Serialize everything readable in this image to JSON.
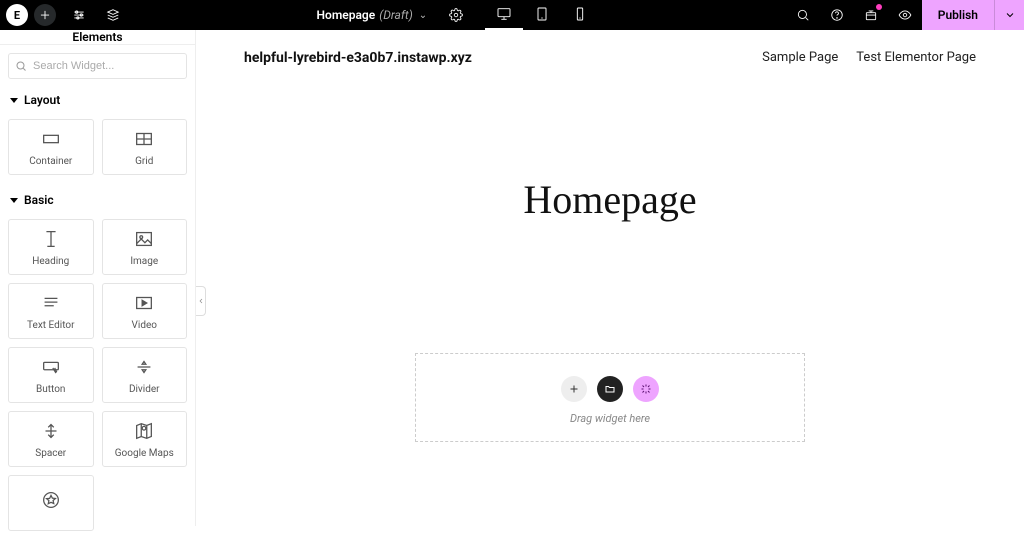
{
  "topbar": {
    "doc_name": "Homepage",
    "doc_status": "(Draft)",
    "publish_label": "Publish"
  },
  "sidebar": {
    "title": "Elements",
    "search_placeholder": "Search Widget...",
    "categories": [
      {
        "id": "layout",
        "label": "Layout",
        "widgets": [
          {
            "id": "container",
            "label": "Container"
          },
          {
            "id": "grid",
            "label": "Grid"
          }
        ]
      },
      {
        "id": "basic",
        "label": "Basic",
        "widgets": [
          {
            "id": "heading",
            "label": "Heading"
          },
          {
            "id": "image",
            "label": "Image"
          },
          {
            "id": "text-editor",
            "label": "Text Editor"
          },
          {
            "id": "video",
            "label": "Video"
          },
          {
            "id": "button",
            "label": "Button"
          },
          {
            "id": "divider",
            "label": "Divider"
          },
          {
            "id": "spacer",
            "label": "Spacer"
          },
          {
            "id": "google-maps",
            "label": "Google Maps"
          },
          {
            "id": "icon",
            "label": ""
          }
        ]
      }
    ]
  },
  "page": {
    "site_url": "helpful-lyrebird-e3a0b7.instawp.xyz",
    "nav": [
      "Sample Page",
      "Test Elementor Page"
    ],
    "hero_title": "Homepage",
    "dropzone_label": "Drag widget here"
  }
}
